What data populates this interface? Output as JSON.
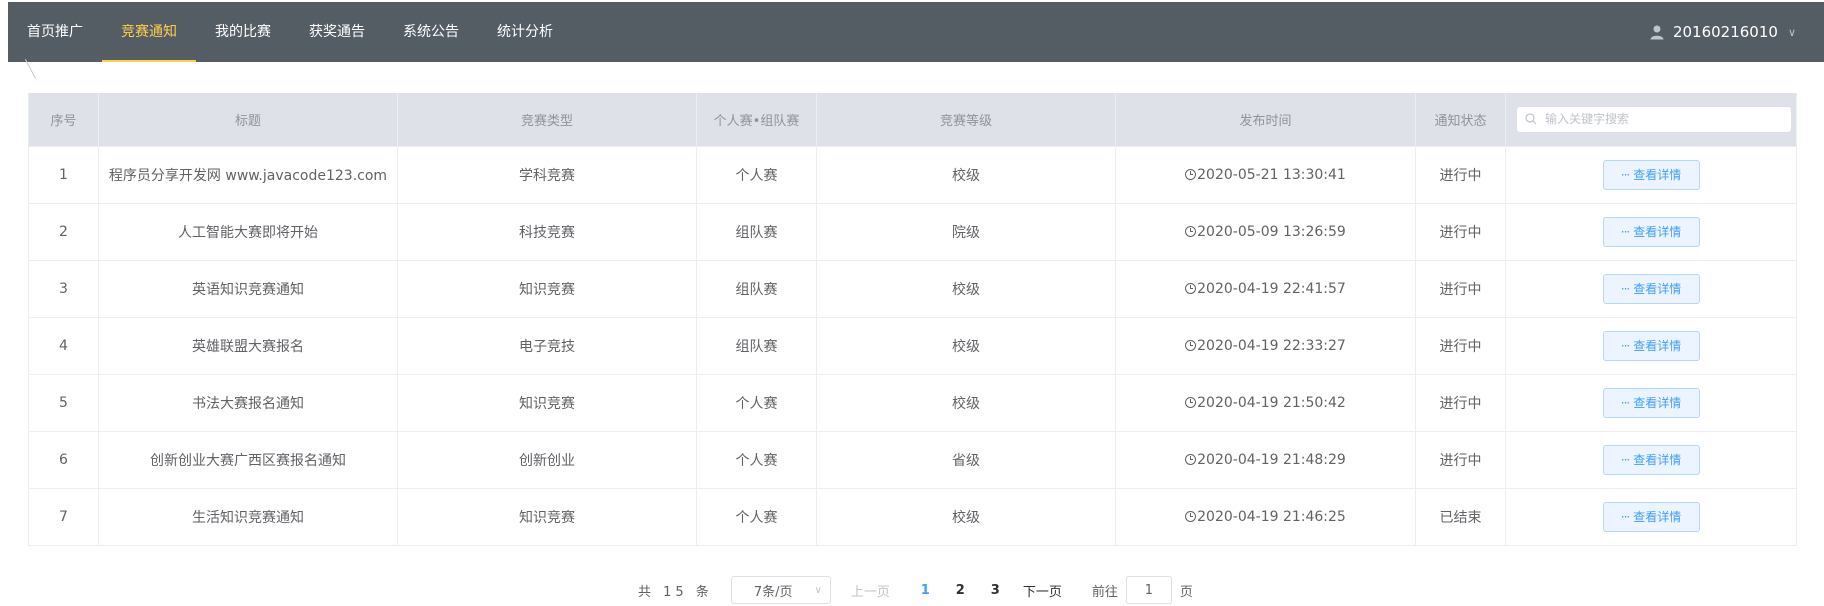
{
  "nav": {
    "items": [
      {
        "label": "首页推广",
        "active": false
      },
      {
        "label": "竞赛通知",
        "active": true
      },
      {
        "label": "我的比赛",
        "active": false
      },
      {
        "label": "获奖通告",
        "active": false
      },
      {
        "label": "系统公告",
        "active": false
      },
      {
        "label": "统计分析",
        "active": false
      }
    ],
    "user": "20160216010",
    "accent_color": "#ffd04b",
    "bg_color": "#545c64"
  },
  "table": {
    "headers": [
      "序号",
      "标题",
      "竞赛类型",
      "个人赛•组队赛",
      "竞赛等级",
      "发布时间",
      "通知状态"
    ],
    "search_placeholder": "输入关键字搜索",
    "detail_label": "查看详情",
    "rows": [
      {
        "index": "1",
        "title": "程序员分享开发网 www.javacode123.com",
        "type": "学科竞赛",
        "mode": "个人赛",
        "level": "校级",
        "time": "2020-05-21 13:30:41",
        "status": "进行中"
      },
      {
        "index": "2",
        "title": "人工智能大赛即将开始",
        "type": "科技竞赛",
        "mode": "组队赛",
        "level": "院级",
        "time": "2020-05-09 13:26:59",
        "status": "进行中"
      },
      {
        "index": "3",
        "title": "英语知识竞赛通知",
        "type": "知识竞赛",
        "mode": "组队赛",
        "level": "校级",
        "time": "2020-04-19 22:41:57",
        "status": "进行中"
      },
      {
        "index": "4",
        "title": "英雄联盟大赛报名",
        "type": "电子竞技",
        "mode": "组队赛",
        "level": "校级",
        "time": "2020-04-19 22:33:27",
        "status": "进行中"
      },
      {
        "index": "5",
        "title": "书法大赛报名通知",
        "type": "知识竞赛",
        "mode": "个人赛",
        "level": "校级",
        "time": "2020-04-19 21:50:42",
        "status": "进行中"
      },
      {
        "index": "6",
        "title": "创新创业大赛广西区赛报名通知",
        "type": "创新创业",
        "mode": "个人赛",
        "level": "省级",
        "time": "2020-04-19 21:48:29",
        "status": "进行中"
      },
      {
        "index": "7",
        "title": "生活知识竞赛通知",
        "type": "知识竞赛",
        "mode": "个人赛",
        "level": "校级",
        "time": "2020-04-19 21:46:25",
        "status": "已结束"
      }
    ]
  },
  "pager": {
    "total_text": "共 15 条",
    "page_size": "7条/页",
    "prev": "上一页",
    "pages": [
      "1",
      "2",
      "3"
    ],
    "current": "1",
    "next": "下一页",
    "goto_prefix": "前往",
    "goto_value": "1",
    "goto_suffix": "页"
  }
}
